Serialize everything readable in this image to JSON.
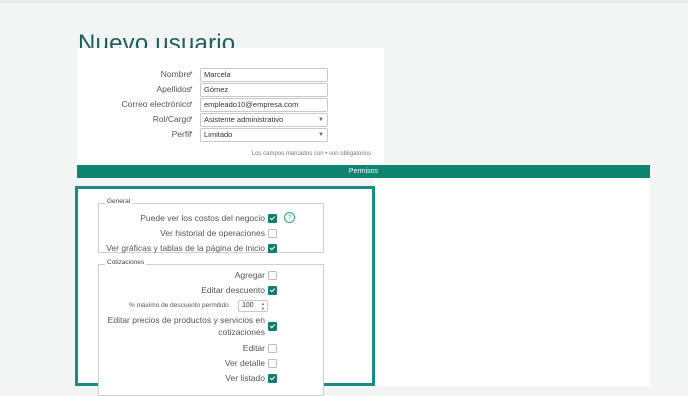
{
  "page": {
    "title": "Nuevo usuario"
  },
  "form": {
    "fields": [
      {
        "label": "Nombre",
        "value": "Marcela",
        "type": "text"
      },
      {
        "label": "Apellidos",
        "value": "Gómez",
        "type": "text"
      },
      {
        "label": "Correo electrónico",
        "value": "empleado10@empresa.com",
        "type": "text"
      },
      {
        "label": "Rol/Cargo",
        "value": "Asistente administrativo",
        "type": "select"
      },
      {
        "label": "Perfil",
        "value": "Limitado",
        "type": "select"
      }
    ],
    "required_mark": "•",
    "required_note": "Los campos marcados con • son obligatorios"
  },
  "permissions": {
    "header": "Permisos",
    "general": {
      "legend": "General",
      "items": [
        {
          "label": "Puede ver los costos del negocio",
          "checked": true,
          "help": "?"
        },
        {
          "label": "Ver historial de operaciones",
          "checked": false
        },
        {
          "label": "Ver gráficas y tablas de la página de inicio",
          "checked": true
        }
      ]
    },
    "cotizaciones": {
      "legend": "Cotizaciones",
      "items": [
        {
          "label": "Agregar",
          "checked": false
        },
        {
          "label": "Editar descuento",
          "checked": true
        },
        {
          "label": "% máximo de descuento permitido",
          "value": "100"
        },
        {
          "label_line1": "Editar precios de productos y servicios en",
          "label_line2": "cotizaciones",
          "checked": true
        },
        {
          "label": "Editar",
          "checked": false
        },
        {
          "label": "Ver detalle",
          "checked": false
        },
        {
          "label": "Ver listado",
          "checked": true
        }
      ]
    }
  },
  "colors": {
    "accent": "#0f8470",
    "frame": "#1e8a84",
    "title": "#1f5f5b"
  }
}
